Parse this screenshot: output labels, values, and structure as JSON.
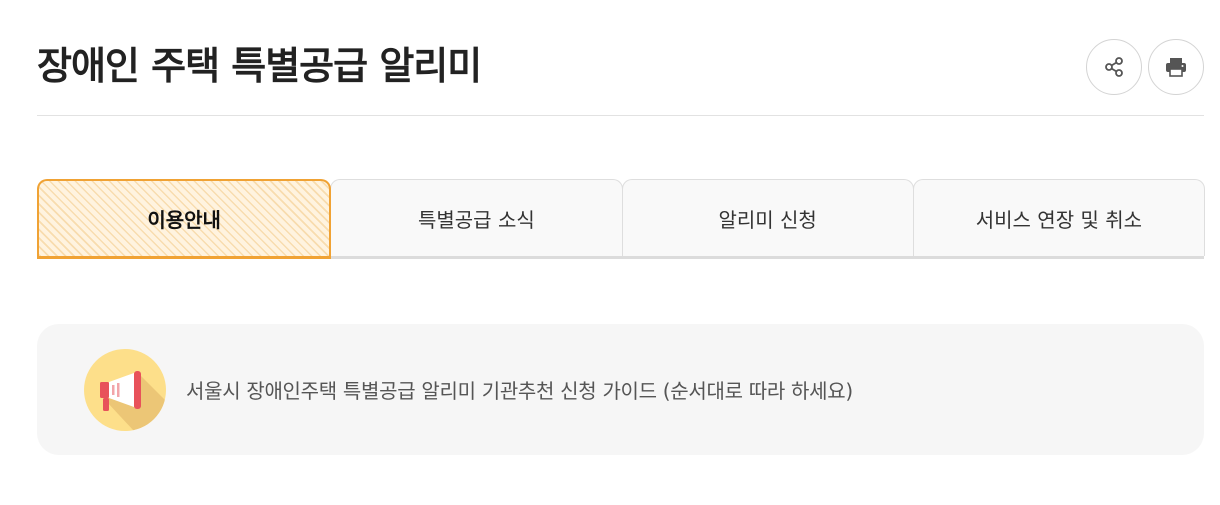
{
  "header": {
    "title": "장애인 주택 특별공급 알리미",
    "actions": [
      {
        "name": "share",
        "icon": "share-icon"
      },
      {
        "name": "print",
        "icon": "print-icon"
      }
    ]
  },
  "tabs": [
    {
      "label": "이용안내",
      "active": true
    },
    {
      "label": "특별공급 소식",
      "active": false
    },
    {
      "label": "알리미 신청",
      "active": false
    },
    {
      "label": "서비스 연장 및 취소",
      "active": false
    }
  ],
  "notice": {
    "icon": "megaphone-icon",
    "text": "서울시 장애인주택 특별공급 알리미 기관추천 신청 가이드 (순서대로 따라 하세요)"
  },
  "colors": {
    "accent": "#f0a234",
    "active_tab_bg": "#fff3df",
    "notice_bg": "#f6f6f6",
    "icon_circle": "#fddf8a"
  }
}
